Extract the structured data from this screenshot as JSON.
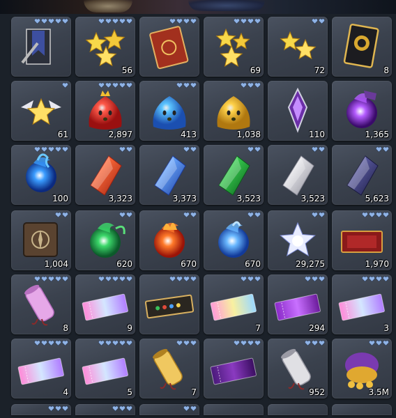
{
  "inventory": {
    "rows": [
      [
        {
          "icon": "black-banner-icon",
          "count": "",
          "hearts": 5
        },
        {
          "icon": "triple-gold-stars-icon",
          "count": "56",
          "hearts": 5
        },
        {
          "icon": "spellbook-icon",
          "count": "",
          "hearts": 4
        },
        {
          "icon": "gold-stars-pair-icon",
          "count": "69",
          "hearts": 4
        },
        {
          "icon": "gold-stars-pair-small-icon",
          "count": "72",
          "hearts": 2
        },
        {
          "icon": "black-card-icon",
          "count": "8",
          "hearts": 0
        }
      ],
      [
        {
          "icon": "single-gold-star-icon",
          "count": "61",
          "hearts": 1
        },
        {
          "icon": "red-slime-icon",
          "count": "2,897",
          "hearts": 5
        },
        {
          "icon": "blue-slime-icon",
          "count": "413",
          "hearts": 3
        },
        {
          "icon": "gold-slime-icon",
          "count": "1,038",
          "hearts": 3
        },
        {
          "icon": "purple-amulet-icon",
          "count": "110",
          "hearts": 0
        },
        {
          "icon": "purple-potion-icon",
          "count": "1,365",
          "hearts": 0
        }
      ],
      [
        {
          "icon": "blue-flame-icon",
          "count": "100",
          "hearts": 5
        },
        {
          "icon": "red-crystal-icon",
          "count": "3,323",
          "hearts": 2
        },
        {
          "icon": "blue-crystal-icon",
          "count": "3,373",
          "hearts": 2
        },
        {
          "icon": "green-crystal-icon",
          "count": "3,523",
          "hearts": 2
        },
        {
          "icon": "white-crystal-icon",
          "count": "3,523",
          "hearts": 2
        },
        {
          "icon": "dark-crystal-icon",
          "count": "5,623",
          "hearts": 2
        }
      ],
      [
        {
          "icon": "compass-scroll-icon",
          "count": "1,004",
          "hearts": 2
        },
        {
          "icon": "green-wind-orb-icon",
          "count": "620",
          "hearts": 2
        },
        {
          "icon": "fire-orb-icon",
          "count": "670",
          "hearts": 2
        },
        {
          "icon": "water-orb-icon",
          "count": "670",
          "hearts": 2
        },
        {
          "icon": "star-burst-icon",
          "count": "29,275",
          "hearts": 2
        },
        {
          "icon": "red-ticket-icon",
          "count": "1,970",
          "hearts": 4
        }
      ],
      [
        {
          "icon": "pink-scroll-icon",
          "count": "8",
          "hearts": 5
        },
        {
          "icon": "rainbow-ticket-icon",
          "count": "9",
          "hearts": 5
        },
        {
          "icon": "gem-ticket-icon",
          "count": "",
          "hearts": 4
        },
        {
          "icon": "holo-ticket-icon",
          "count": "7",
          "hearts": 3
        },
        {
          "icon": "purple-ticket-icon",
          "count": "294",
          "hearts": 3
        },
        {
          "icon": "rainbow-ticket-icon",
          "count": "3",
          "hearts": 4
        }
      ],
      [
        {
          "icon": "rainbow-ticket-icon",
          "count": "4",
          "hearts": 5
        },
        {
          "icon": "rainbow-ticket-icon",
          "count": "5",
          "hearts": 5
        },
        {
          "icon": "gold-scroll-icon",
          "count": "7",
          "hearts": 3
        },
        {
          "icon": "purple-gem-ticket-icon",
          "count": "",
          "hearts": 4
        },
        {
          "icon": "silver-scroll-icon",
          "count": "952",
          "hearts": 3
        },
        {
          "icon": "gold-coin-pouch-icon",
          "count": "3.5M",
          "hearts": 3
        }
      ]
    ],
    "partial_row": [
      {
        "hearts": 3
      },
      {
        "hearts": 3
      },
      {
        "hearts": 2
      },
      {
        "hearts": 0
      },
      {
        "hearts": 0
      },
      {
        "hearts": 0
      }
    ],
    "heart_color": "#8fb3e6"
  }
}
